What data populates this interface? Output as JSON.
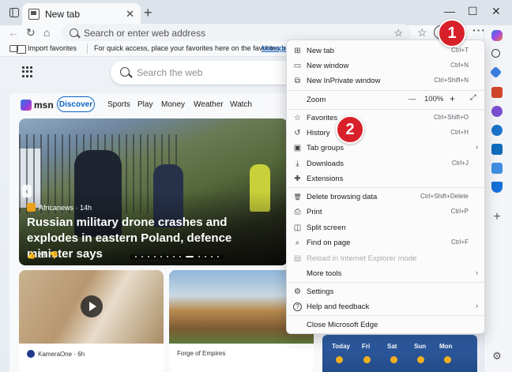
{
  "tab": {
    "title": "New tab",
    "close": "✕"
  },
  "new_tab_button": "+",
  "window_controls": {
    "minimize": "—",
    "maximize": "☐",
    "close": "✕"
  },
  "address_bar": {
    "placeholder": "Search or enter web address"
  },
  "favorites_bar": {
    "import_label": "Import favorites",
    "tip": "For quick access, place your favorites here on the favorites bar.",
    "manage_link": "Manage f"
  },
  "search_box": {
    "placeholder": "Search the web"
  },
  "msn": {
    "logo": "msn",
    "nav": [
      "Discover",
      "Sports",
      "Play",
      "Money",
      "Weather",
      "Watch"
    ],
    "hero": {
      "source": "Africanews · 14h",
      "headline": "Russian military drone crashes and explodes in eastern Poland, defence minister says",
      "likes": "28"
    },
    "cards": [
      {
        "source": "KameraOne · 6h"
      },
      {
        "source": "Forge of Empires"
      }
    ],
    "weather_days": [
      "Today",
      "Fri",
      "Sat",
      "Sun",
      "Mon"
    ]
  },
  "menu": {
    "items": [
      {
        "label": "New tab",
        "shortcut": "Ctrl+T",
        "icon": "new-tab-icon",
        "glyph": "⊞"
      },
      {
        "label": "New window",
        "shortcut": "Ctrl+N",
        "icon": "new-window-icon",
        "glyph": "▭"
      },
      {
        "label": "New InPrivate window",
        "shortcut": "Ctrl+Shift+N",
        "icon": "inprivate-icon",
        "glyph": "⧉"
      },
      {
        "label": "Zoom",
        "zoom_value": "100%",
        "icon": "zoom-icon"
      },
      {
        "label": "Favorites",
        "shortcut": "Ctrl+Shift+O",
        "icon": "favorites-icon",
        "glyph": "☆"
      },
      {
        "label": "History",
        "shortcut": "Ctrl+H",
        "icon": "history-icon",
        "glyph": "↺"
      },
      {
        "label": "Tab groups",
        "icon": "tab-groups-icon",
        "glyph": "▣",
        "submenu": true
      },
      {
        "label": "Downloads",
        "shortcut": "Ctrl+J",
        "icon": "downloads-icon",
        "glyph": "⤓"
      },
      {
        "label": "Extensions",
        "icon": "extensions-icon",
        "glyph": "✚"
      },
      {
        "label": "Delete browsing data",
        "shortcut": "Ctrl+Shift+Delete",
        "icon": "delete-icon",
        "glyph": "🗑"
      },
      {
        "label": "Print",
        "shortcut": "Ctrl+P",
        "icon": "print-icon",
        "glyph": "⎙"
      },
      {
        "label": "Split screen",
        "icon": "split-screen-icon",
        "glyph": "◫"
      },
      {
        "label": "Find on page",
        "shortcut": "Ctrl+F",
        "icon": "find-icon",
        "glyph": "⌕"
      },
      {
        "label": "Reload in Internet Explorer mode",
        "icon": "ie-mode-icon",
        "glyph": "▤",
        "disabled": true
      },
      {
        "label": "More tools",
        "icon": "more-tools-icon",
        "submenu": true
      },
      {
        "label": "Settings",
        "icon": "settings-icon",
        "glyph": "⚙"
      },
      {
        "label": "Help and feedback",
        "icon": "help-icon",
        "glyph": "?",
        "submenu": true
      },
      {
        "label": "Close Microsoft Edge",
        "icon": "close-edge-icon"
      }
    ]
  },
  "callouts": [
    "1",
    "2"
  ],
  "colors": {
    "accent": "#0b61c4",
    "callout": "#d8202a"
  }
}
